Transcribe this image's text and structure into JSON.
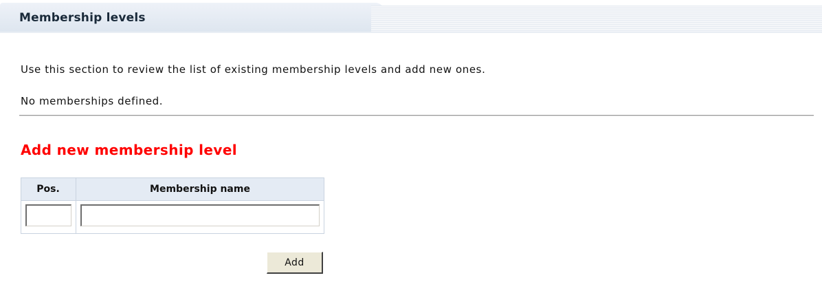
{
  "header": {
    "title": "Membership levels"
  },
  "intro_text": "Use this section to review the list of existing membership levels and add new ones.",
  "empty_text": "No memberships defined.",
  "add_section": {
    "title": "Add new membership level",
    "columns": [
      "Pos.",
      "Membership name"
    ],
    "pos_value": "",
    "name_value": "",
    "add_label": "Add"
  },
  "colors": {
    "section_title": "#ff0000",
    "header_bg": "#dde5ef",
    "table_header_bg": "#e4ebf4",
    "button_bg": "#ece9d8"
  }
}
